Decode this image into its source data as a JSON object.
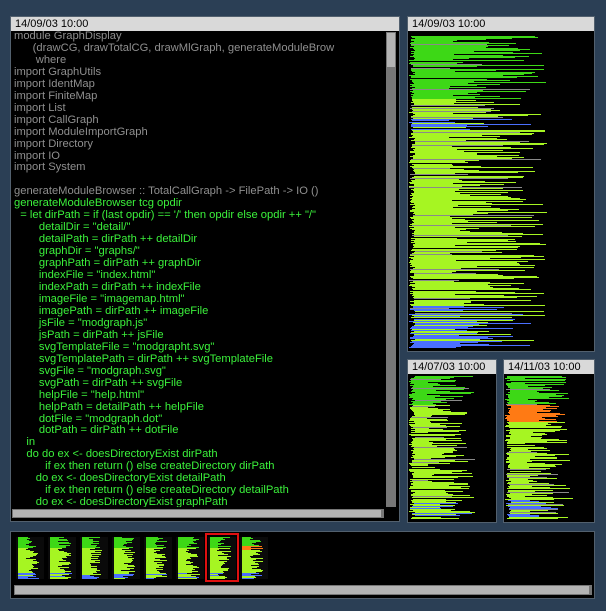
{
  "source_view": {
    "title": "14/09/03 10:00",
    "lines": [
      {
        "t": "module GraphDisplay",
        "dim": true
      },
      {
        "t": "      (drawCG, drawTotalCG, drawMlGraph, generateModuleBrow",
        "dim": true
      },
      {
        "t": "       where",
        "dim": true
      },
      {
        "t": "import GraphUtils",
        "dim": true
      },
      {
        "t": "import IdentMap",
        "dim": true
      },
      {
        "t": "import FiniteMap",
        "dim": true
      },
      {
        "t": "import List",
        "dim": true
      },
      {
        "t": "import CallGraph",
        "dim": true
      },
      {
        "t": "import ModuleImportGraph",
        "dim": true
      },
      {
        "t": "import Directory",
        "dim": true
      },
      {
        "t": "import IO",
        "dim": true
      },
      {
        "t": "import System",
        "dim": true
      },
      {
        "t": "",
        "dim": true
      },
      {
        "t": "generateModuleBrowser :: TotalCallGraph -> FilePath -> IO ()",
        "dim": true
      },
      {
        "t": "generateModuleBrowser tcg opdir",
        "dim": false
      },
      {
        "t": "  = let dirPath = if (last opdir) == '/' then opdir else opdir ++ \"/\"",
        "dim": false
      },
      {
        "t": "        detailDir = \"detail/\"",
        "dim": false
      },
      {
        "t": "        detailPath = dirPath ++ detailDir",
        "dim": false
      },
      {
        "t": "        graphDir = \"graphs/\"",
        "dim": false
      },
      {
        "t": "        graphPath = dirPath ++ graphDir",
        "dim": false
      },
      {
        "t": "        indexFile = \"index.html\"",
        "dim": false
      },
      {
        "t": "        indexPath = dirPath ++ indexFile",
        "dim": false
      },
      {
        "t": "        imageFile = \"imagemap.html\"",
        "dim": false
      },
      {
        "t": "        imagePath = dirPath ++ imageFile",
        "dim": false
      },
      {
        "t": "        jsFile = \"modgraph.js\"",
        "dim": false
      },
      {
        "t": "        jsPath = dirPath ++ jsFile",
        "dim": false
      },
      {
        "t": "        svgTemplateFile = \"modgrapht.svg\"",
        "dim": false
      },
      {
        "t": "        svgTemplatePath = dirPath ++ svgTemplateFile",
        "dim": false
      },
      {
        "t": "        svgFile = \"modgraph.svg\"",
        "dim": false
      },
      {
        "t": "        svgPath = dirPath ++ svgFile",
        "dim": false
      },
      {
        "t": "        helpFile = \"help.html\"",
        "dim": false
      },
      {
        "t": "        helpPath = detailPath ++ helpFile",
        "dim": false
      },
      {
        "t": "        dotFile = \"modgraph.dot\"",
        "dim": false
      },
      {
        "t": "        dotPath = dirPath ++ dotFile",
        "dim": false
      },
      {
        "t": "    in",
        "dim": false
      },
      {
        "t": "    do do ex <- doesDirectoryExist dirPath",
        "dim": false
      },
      {
        "t": "          if ex then return () else createDirectory dirPath",
        "dim": false
      },
      {
        "t": "       do ex <- doesDirectoryExist detailPath",
        "dim": false
      },
      {
        "t": "          if ex then return () else createDirectory detailPath",
        "dim": false
      },
      {
        "t": "       do ex <- doesDirectoryExist graphPath",
        "dim": false
      }
    ]
  },
  "thumb_views": [
    {
      "id": "main",
      "title": "14/09/03 10:00",
      "orange": false
    },
    {
      "id": "left",
      "title": "14/07/03 10:00",
      "orange": false
    },
    {
      "id": "right",
      "title": "14/11/03 10:00",
      "orange": true
    }
  ],
  "timeline": {
    "snapshot_count": 8,
    "selected_index": 6,
    "colors": {
      "green": "#3dd816",
      "lime": "#a6f522",
      "blue": "#4a6fff",
      "orange": "#ff7a14",
      "grey": "#8a8a8a"
    }
  }
}
